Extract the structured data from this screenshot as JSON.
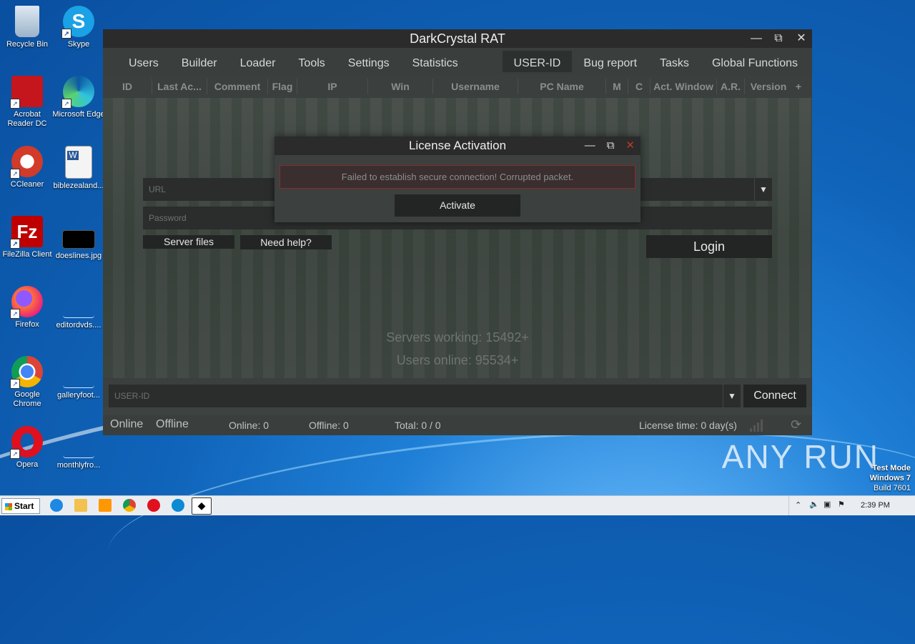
{
  "desktop": {
    "icons": [
      {
        "label": "Recycle Bin"
      },
      {
        "label": "Skype"
      },
      {
        "label": "Acrobat Reader DC"
      },
      {
        "label": "Microsoft Edge"
      },
      {
        "label": "CCleaner"
      },
      {
        "label": "biblezealand..."
      },
      {
        "label": "FileZilla Client"
      },
      {
        "label": "doeslines.jpg"
      },
      {
        "label": "Firefox"
      },
      {
        "label": "editordvds...."
      },
      {
        "label": "Google Chrome"
      },
      {
        "label": "galleryfoot..."
      },
      {
        "label": "Opera"
      },
      {
        "label": "monthlyfro..."
      }
    ]
  },
  "window": {
    "title": "DarkCrystal RAT",
    "menu": [
      "Users",
      "Builder",
      "Loader",
      "Tools",
      "Settings",
      "Statistics",
      "USER-ID",
      "Bug report",
      "Tasks",
      "Global Functions"
    ],
    "columns": [
      "ID",
      "Last Ac...",
      "Comment",
      "Flag",
      "IP",
      "Win",
      "Username",
      "PC Name",
      "M",
      "C",
      "Act. Window",
      "A.R.",
      "Version",
      "+"
    ]
  },
  "login": {
    "url_placeholder": "URL",
    "password_placeholder": "Password",
    "server_files_label": "Server files",
    "need_help_label": "Need help?",
    "login_label": "Login",
    "servers_working": "Servers working: 15492+",
    "users_online": "Users online: 95534+"
  },
  "bottom": {
    "userid_placeholder": "USER-ID",
    "connect_label": "Connect"
  },
  "status": {
    "online_label": "Online",
    "offline_label": "Offline",
    "online_count": "Online: 0",
    "offline_count": "Offline: 0",
    "total": "Total: 0 / 0",
    "license_time": "License time: 0 day(s)"
  },
  "dialog": {
    "title": "License Activation",
    "message": "Failed to establish secure connection! Corrupted packet.",
    "activate_label": "Activate"
  },
  "taskbar": {
    "start_label": "Start",
    "clock": "2:39 PM"
  },
  "watermark": {
    "brand": "ANY RUN",
    "test_mode": "Test Mode",
    "os": "Windows 7",
    "build": "Build 7601"
  },
  "colors": {
    "window_bg": "#3e4342",
    "titlebar_bg": "#2b2b2b",
    "error_border": "#8a2b2b",
    "close_red": "#c0392b"
  }
}
